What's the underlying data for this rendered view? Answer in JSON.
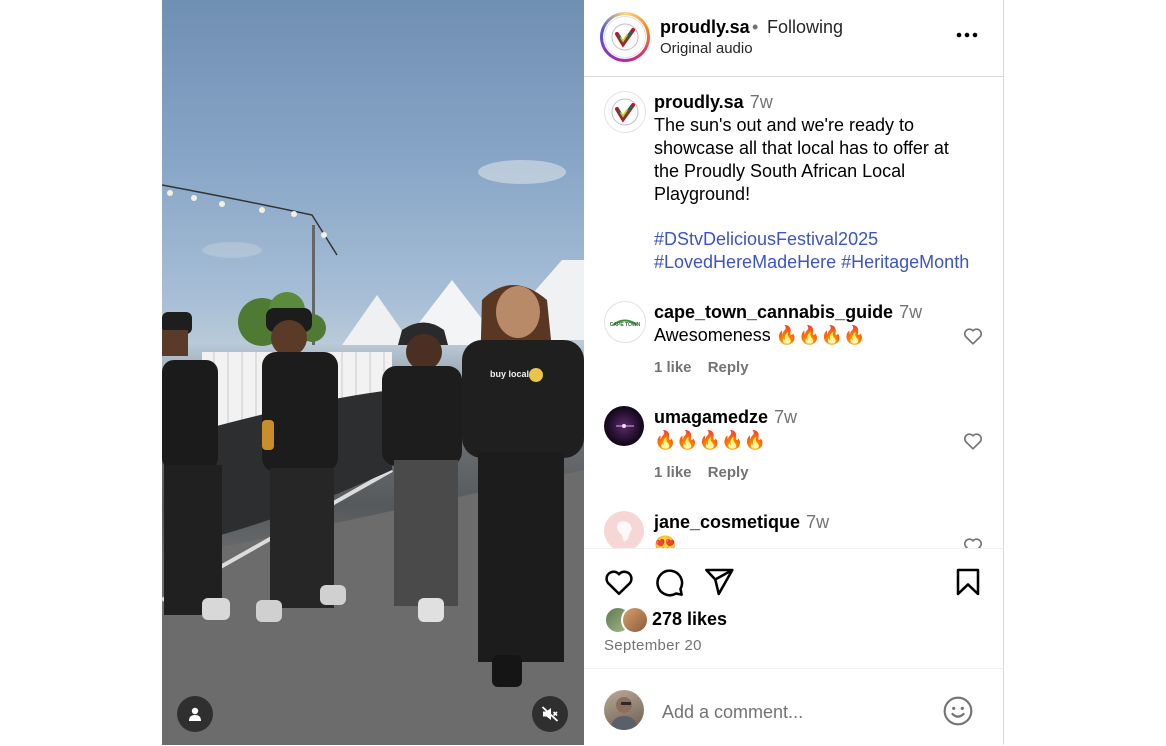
{
  "media": {
    "user_tag_icon": "person-icon",
    "mute_icon": "speaker-muted-icon",
    "shirt_text": "buy local"
  },
  "header": {
    "username": "proudly.sa",
    "separator": "•",
    "follow_state": "Following",
    "subtitle": "Original audio",
    "more_icon": "more-horizontal-icon"
  },
  "caption": {
    "username": "proudly.sa",
    "ago": "7w",
    "text": "The sun's out and we're ready to showcase all that local has to offer at the Proudly South African Local Playground!",
    "hashtag_1": "#DStvDeliciousFestival2025",
    "hashtag_2": "#LovedHereMadeHere",
    "hashtag_3": "#HeritageMonth"
  },
  "comments": [
    {
      "username": "cape_town_cannabis_guide",
      "ago": "7w",
      "text": "Awesomeness 🔥🔥🔥🔥",
      "likes": "1 like",
      "reply": "Reply",
      "avatar_text": "CAPE TOWN"
    },
    {
      "username": "umagamedze",
      "ago": "7w",
      "text": "🔥🔥🔥🔥🔥",
      "likes": "1 like",
      "reply": "Reply"
    },
    {
      "username": "jane_cosmetique",
      "ago": "7w",
      "text": "😍"
    }
  ],
  "actions": {
    "like_icon": "heart-icon",
    "comment_icon": "comment-icon",
    "share_icon": "paper-plane-icon",
    "save_icon": "bookmark-icon"
  },
  "likes": "278 likes",
  "date": "September 20",
  "add_comment": {
    "placeholder": "Add a comment...",
    "emoji_icon": "smiley-icon"
  },
  "colors": {
    "hashtag": "#3b54c9",
    "muted_text": "#737373",
    "border": "#dbdbdb"
  }
}
